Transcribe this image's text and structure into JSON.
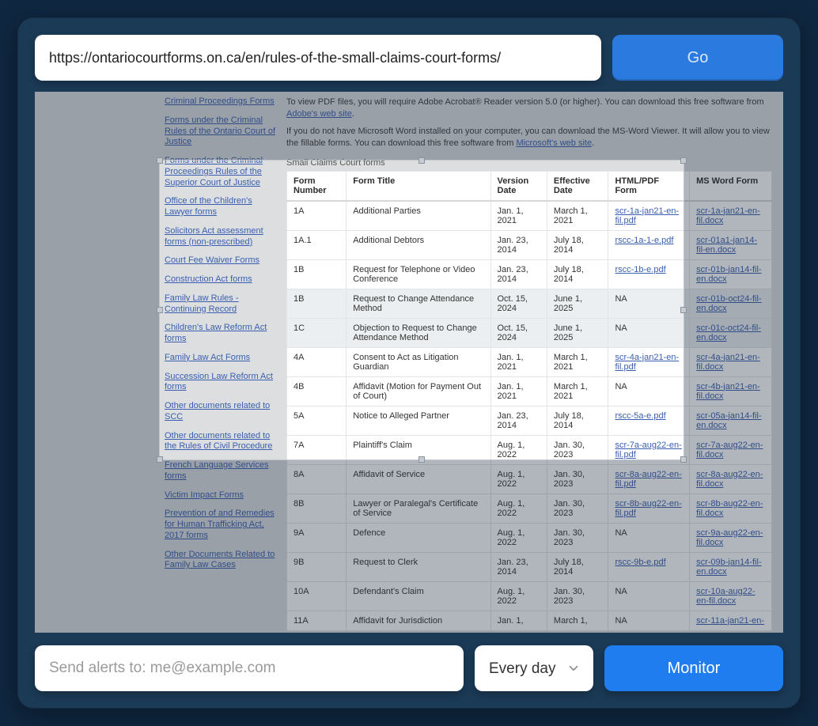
{
  "topbar": {
    "url_value": "https://ontariocourtforms.on.ca/en/rules-of-the-small-claims-court-forms/",
    "go_label": "Go"
  },
  "page": {
    "sidebar_links": [
      "Criminal Proceedings Forms",
      "Forms under the Criminal Rules of the Ontario Court of Justice",
      "Forms under the Criminal Proceedings Rules of the Superior Court of Justice",
      "Office of the Children's Lawyer forms",
      "Solicitors Act assessment forms (non-prescribed)",
      "Court Fee Waiver Forms",
      "Construction Act forms",
      "Family Law Rules - Continuing Record",
      "Children's Law Reform Act forms",
      "Family Law Act Forms",
      "Succession Law Reform Act forms",
      "Other documents related to SCC",
      "Other documents related to the Rules of Civil Procedure",
      "French Language Services forms",
      "Victim Impact Forms",
      "Prevention of and Remedies for Human Trafficking Act, 2017 forms",
      "Other Documents Related to Family Law Cases"
    ],
    "intro1_prefix": "To view PDF files, you will require Adobe Acrobat® Reader version 5.0 (or higher). You can download this free software from ",
    "intro1_link": "Adobe's web site",
    "intro1_suffix": ".",
    "intro2_prefix": "If you do not have Microsoft Word installed on your computer, you can download the MS-Word Viewer. It will allow you to view the fillable forms. You can download this free software from ",
    "intro2_link": "Microsoft's web site",
    "intro2_suffix": ".",
    "table_caption": "Small Claims Court forms",
    "columns": [
      "Form Number",
      "Form Title",
      "Version Date",
      "Effective Date",
      "HTML/PDF Form",
      "MS Word Form"
    ],
    "rows": [
      {
        "num": "1A",
        "title": "Additional Parties",
        "ver": "Jan. 1, 2021",
        "eff": "March 1, 2021",
        "pdf": "scr-1a-jan21-en-fil.pdf",
        "word": "scr-1a-jan21-en-fil.docx"
      },
      {
        "num": "1A.1",
        "title": "Additional Debtors",
        "ver": "Jan. 23, 2014",
        "eff": "July 18, 2014",
        "pdf": "rscc-1a-1-e.pdf",
        "word": "scr-01a1-jan14-fil-en.docx"
      },
      {
        "num": "1B",
        "title": "Request for Telephone or Video Conference",
        "ver": "Jan. 23, 2014",
        "eff": "July 18, 2014",
        "pdf": "rscc-1b-e.pdf",
        "word": "scr-01b-jan14-fil-en.docx"
      },
      {
        "num": "1B",
        "title": "Request to Change Attendance Method",
        "ver": "Oct. 15, 2024",
        "eff": "June 1, 2025",
        "pdf": "NA",
        "word": "scr-01b-oct24-fil-en.docx",
        "shade": true
      },
      {
        "num": "1C",
        "title": "Objection to Request to Change Attendance Method",
        "ver": "Oct. 15, 2024",
        "eff": "June 1, 2025",
        "pdf": "NA",
        "word": "scr-01c-oct24-fil-en.docx",
        "shade": true
      },
      {
        "num": "4A",
        "title": "Consent to Act as Litigation Guardian",
        "ver": "Jan. 1, 2021",
        "eff": "March 1, 2021",
        "pdf": "scr-4a-jan21-en-fil.pdf",
        "word": "scr-4a-jan21-en-fil.docx"
      },
      {
        "num": "4B",
        "title": "Affidavit (Motion for Payment Out of Court)",
        "ver": "Jan. 1, 2021",
        "eff": "March 1, 2021",
        "pdf": "NA",
        "word": "scr-4b-jan21-en-fil.docx"
      },
      {
        "num": "5A",
        "title": "Notice to Alleged Partner",
        "ver": "Jan. 23, 2014",
        "eff": "July 18, 2014",
        "pdf": "rscc-5a-e.pdf",
        "word": "scr-05a-jan14-fil-en.docx"
      },
      {
        "num": "7A",
        "title": "Plaintiff's Claim",
        "ver": "Aug. 1, 2022",
        "eff": "Jan. 30, 2023",
        "pdf": "scr-7a-aug22-en-fil.pdf",
        "word": "scr-7a-aug22-en-fil.docx"
      },
      {
        "num": "8A",
        "title": "Affidavit of Service",
        "ver": "Aug. 1, 2022",
        "eff": "Jan. 30, 2023",
        "pdf": "scr-8a-aug22-en-fil.pdf",
        "word": "scr-8a-aug22-en-fil.docx"
      },
      {
        "num": "8B",
        "title": "Lawyer or Paralegal's Certificate of Service",
        "ver": "Aug. 1, 2022",
        "eff": "Jan. 30, 2023",
        "pdf": "scr-8b-aug22-en-fil.pdf",
        "word": "scr-8b-aug22-en-fil.docx"
      },
      {
        "num": "9A",
        "title": "Defence",
        "ver": "Aug. 1, 2022",
        "eff": "Jan. 30, 2023",
        "pdf": "NA",
        "word": "scr-9a-aug22-en-fil.docx"
      },
      {
        "num": "9B",
        "title": "Request to Clerk",
        "ver": "Jan. 23, 2014",
        "eff": "July 18, 2014",
        "pdf": "rscc-9b-e.pdf",
        "word": "scr-09b-jan14-fil-en.docx"
      },
      {
        "num": "10A",
        "title": "Defendant's Claim",
        "ver": "Aug. 1, 2022",
        "eff": "Jan. 30, 2023",
        "pdf": "NA",
        "word": "scr-10a-aug22-en-fil.docx"
      },
      {
        "num": "11A",
        "title": "Affidavit for Jurisdiction",
        "ver": "Jan. 1,",
        "eff": "March 1,",
        "pdf": "NA",
        "word": "scr-11a-jan21-en-"
      }
    ]
  },
  "bottombar": {
    "alert_placeholder": "Send alerts to: me@example.com",
    "frequency_value": "Every day",
    "monitor_label": "Monitor"
  }
}
